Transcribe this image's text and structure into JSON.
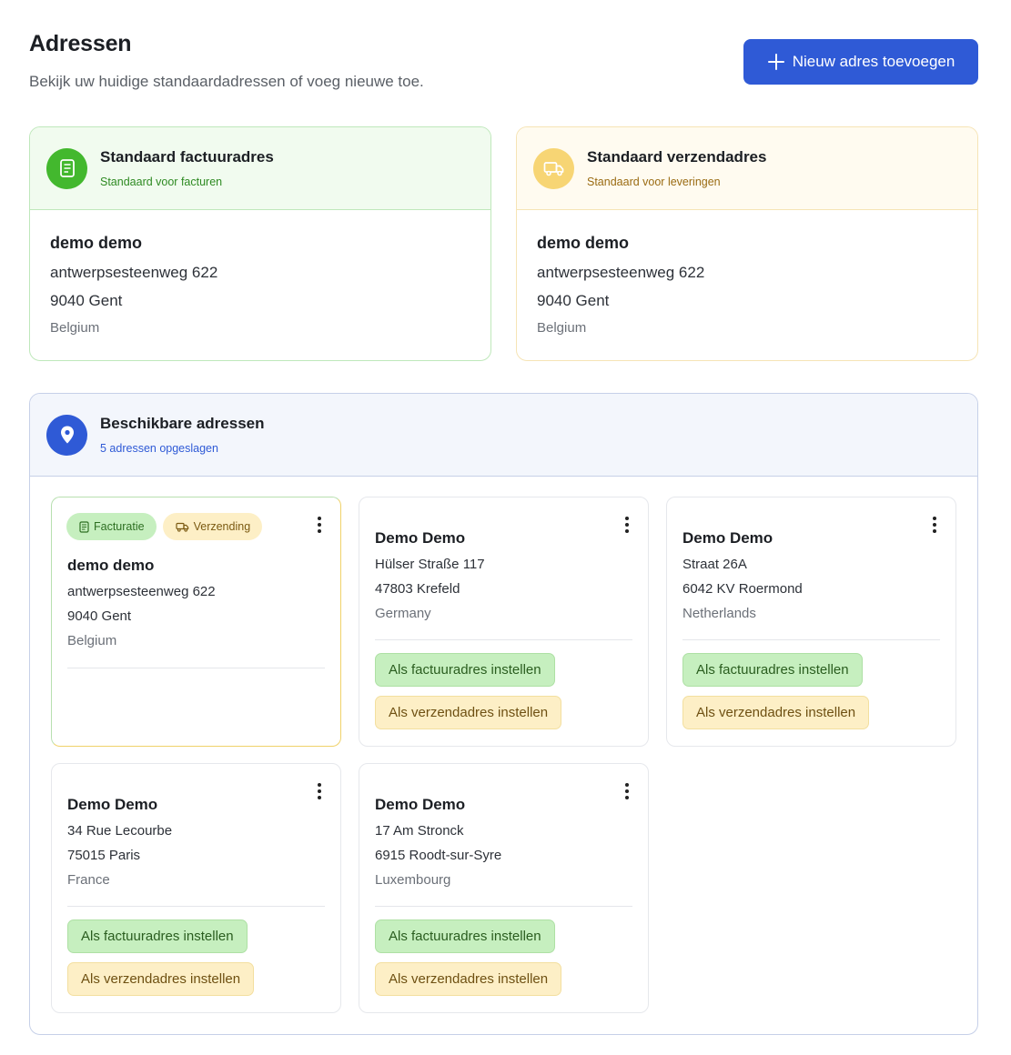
{
  "header": {
    "title": "Adressen",
    "subtitle": "Bekijk uw huidige standaardadressen of voeg nieuwe toe.",
    "add_button_label": "Nieuw adres toevoegen"
  },
  "default_billing": {
    "title": "Standaard factuuradres",
    "subtitle": "Standaard voor facturen",
    "name": "demo demo",
    "street": "antwerpsesteenweg 622",
    "city": "9040 Gent",
    "country": "Belgium"
  },
  "default_shipping": {
    "title": "Standaard verzendadres",
    "subtitle": "Standaard voor leveringen",
    "name": "demo demo",
    "street": "antwerpsesteenweg 622",
    "city": "9040 Gent",
    "country": "Belgium"
  },
  "available": {
    "title": "Beschikbare adressen",
    "subtitle": "5 adressen opgeslagen",
    "badge_billing": "Facturatie",
    "badge_shipping": "Verzending",
    "set_billing_label": "Als factuuradres instellen",
    "set_shipping_label": "Als verzendadres instellen",
    "addresses": [
      {
        "name": "demo demo",
        "street": "antwerpsesteenweg 622",
        "city": "9040 Gent",
        "country": "Belgium"
      },
      {
        "name": "Demo Demo",
        "street": "Hülser Straße 117",
        "city": "47803 Krefeld",
        "country": "Germany"
      },
      {
        "name": "Demo Demo",
        "street": "Straat 26A",
        "city": "6042 KV Roermond",
        "country": "Netherlands"
      },
      {
        "name": "Demo Demo",
        "street": "34 Rue Lecourbe",
        "city": "75015 Paris",
        "country": "France"
      },
      {
        "name": "Demo Demo",
        "street": "17 Am Stronck",
        "city": "6915 Roodt-sur-Syre",
        "country": "Luxembourg"
      }
    ]
  },
  "colors": {
    "accent_blue": "#2f5ad6",
    "billing_green": "#43b82e",
    "shipping_yellow": "#f7d574"
  }
}
